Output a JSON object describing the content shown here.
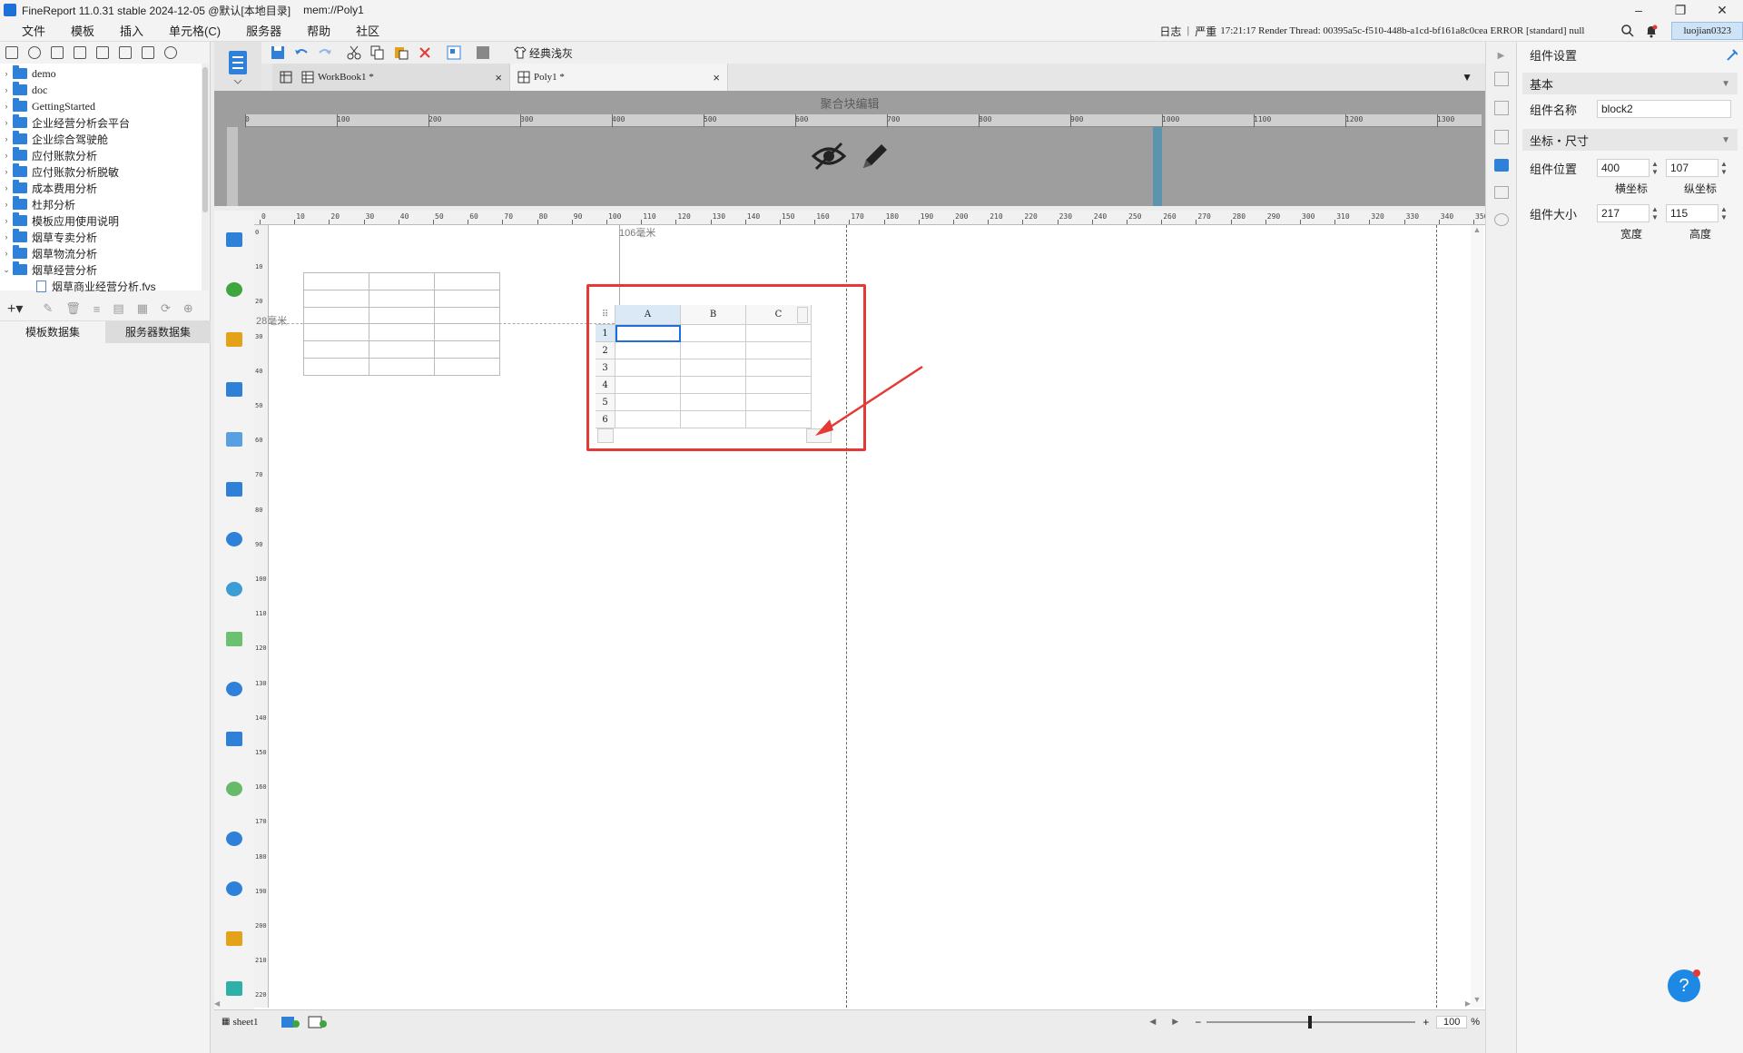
{
  "titlebar": {
    "app": "FineReport 11.0.31 stable 2024-12-05 @默认[本地目录]",
    "path": "mem://Poly1",
    "min": "–",
    "restore": "❐",
    "close": "✕"
  },
  "menu": [
    "文件",
    "模板",
    "插入",
    "单元格(C)",
    "服务器",
    "帮助",
    "社区"
  ],
  "logbar": {
    "log_label": "日志",
    "severity": "严重",
    "message": "17:21:17 Render Thread: 00395a5c-f510-448b-a1cd-bf161a8c0cea ERROR [standard] null",
    "user": "luojian0323"
  },
  "tree": [
    {
      "name": "demo",
      "arrow": "›"
    },
    {
      "name": "doc",
      "arrow": "›"
    },
    {
      "name": "GettingStarted",
      "arrow": "›"
    },
    {
      "name": "企业经营分析会平台",
      "arrow": "›"
    },
    {
      "name": "企业综合驾驶舱",
      "arrow": "›"
    },
    {
      "name": "应付账款分析",
      "arrow": "›"
    },
    {
      "name": "应付账款分析脱敏",
      "arrow": "›"
    },
    {
      "name": "成本费用分析",
      "arrow": "›"
    },
    {
      "name": "杜邦分析",
      "arrow": "›"
    },
    {
      "name": "模板应用使用说明",
      "arrow": "›"
    },
    {
      "name": "烟草专卖分析",
      "arrow": "›"
    },
    {
      "name": "烟草物流分析",
      "arrow": "›"
    },
    {
      "name": "烟草经营分析",
      "arrow": "⌄"
    }
  ],
  "tree_file": "烟草商业经营分析.fvs",
  "dataset_tabs": [
    "模板数据集",
    "服务器数据集"
  ],
  "toolbar": {
    "theme_button": "经典浅灰"
  },
  "tabs": [
    {
      "label": "WorkBook1 *",
      "close": "×"
    },
    {
      "label": "Poly1 *",
      "close": "×"
    }
  ],
  "poly": {
    "header_label": "聚合块编辑"
  },
  "ruler_top_labels": [
    "0",
    "100",
    "200",
    "300",
    "400",
    "500",
    "600",
    "700",
    "800",
    "900",
    "1000",
    "1100",
    "1200",
    "1300"
  ],
  "mm_ruler_labels": [
    "0",
    "10",
    "20",
    "30",
    "40",
    "50",
    "60",
    "70",
    "80",
    "90",
    "100",
    "110",
    "120",
    "130",
    "140",
    "150",
    "160",
    "170",
    "180",
    "190",
    "200",
    "210",
    "220",
    "230",
    "240",
    "250",
    "260",
    "270",
    "280",
    "290",
    "300",
    "310",
    "320",
    "330",
    "340",
    "350"
  ],
  "left_ruler_labels": [
    "0",
    "10",
    "20",
    "30",
    "40",
    "50",
    "60",
    "70",
    "80",
    "90",
    "100",
    "110",
    "120",
    "130",
    "140",
    "150",
    "160",
    "170",
    "180",
    "190",
    "200",
    "210",
    "220"
  ],
  "guides": {
    "horizontal_label": "106毫米",
    "vertical_label": "28毫米"
  },
  "block": {
    "columns": [
      "A",
      "B",
      "C"
    ],
    "rows": [
      "1",
      "2",
      "3",
      "4",
      "5",
      "6"
    ]
  },
  "bottom": {
    "sheet": "sheet1",
    "zoom": "100",
    "zoom_unit": "%",
    "minus": "−",
    "plus": "+"
  },
  "rpanel": {
    "title": "组件设置",
    "basic": "基本",
    "name_label": "组件名称",
    "name_value": "block2",
    "coord_section": "坐标・尺寸",
    "pos_label": "组件位置",
    "x_value": "400",
    "y_value": "107",
    "x_caption": "横坐标",
    "y_caption": "纵坐标",
    "size_label": "组件大小",
    "w_value": "217",
    "h_value": "115",
    "w_caption": "宽度",
    "h_caption": "高度"
  },
  "help_button": "?",
  "colors": {
    "accent": "#1e88e5",
    "highlight": "#e53935",
    "blue_icon": "#2f80d8"
  }
}
